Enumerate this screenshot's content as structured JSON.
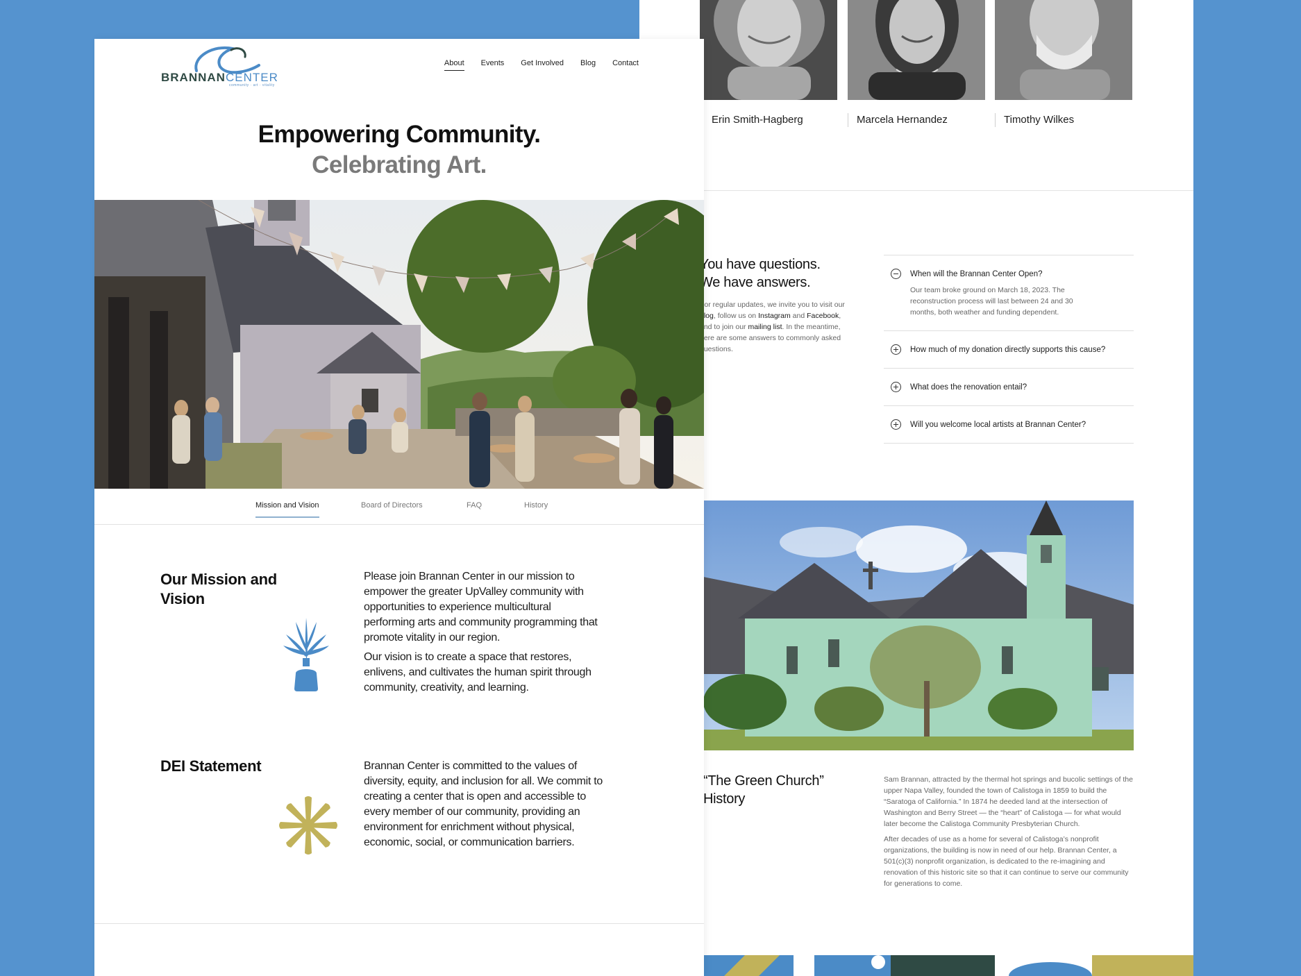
{
  "logo": {
    "name_bold": "BRANNAN",
    "name_light": "CENTER",
    "tagline": "community · art · vitality"
  },
  "nav": {
    "items": [
      {
        "label": "About",
        "active": true
      },
      {
        "label": "Events"
      },
      {
        "label": "Get Involved"
      },
      {
        "label": "Blog"
      },
      {
        "label": "Contact"
      }
    ]
  },
  "hero": {
    "line1": "Empowering Community.",
    "line2": "Celebrating Art."
  },
  "subtabs": [
    {
      "label": "Mission and Vision",
      "active": true
    },
    {
      "label": "Board of Directors"
    },
    {
      "label": "FAQ"
    },
    {
      "label": "History"
    }
  ],
  "mission": {
    "heading": "Our Mission and Vision",
    "p1": "Please join Brannan Center in our mission to empower the greater UpValley community with opportunities to experience multicultural performing arts and community programming that promote vitality in our region.",
    "p2": "Our vision is to create a space that restores, enlivens, and cultivates the human spirit through community, creativity, and learning."
  },
  "dei": {
    "heading": "DEI Statement",
    "p1": "Brannan Center is committed to the values of diversity, equity, and inclusion for all. We commit to creating a center that is open and accessible to every member of our community, providing an environment for enrichment without physical, economic, social, or communication barriers."
  },
  "board": {
    "members": [
      "Erin Smith-Hagberg",
      "Marcela Hernandez",
      "Timothy Wilkes"
    ]
  },
  "faq": {
    "heading_l1": "You have questions.",
    "heading_l2": "We have answers.",
    "intro_a": "For regular updates, we invite you to visit our ",
    "intro_blog": "blog",
    "intro_b": ", follow us on ",
    "intro_instagram": "Instagram",
    "intro_c": " and ",
    "intro_facebook": "Facebook",
    "intro_d": ", and to join our ",
    "intro_mailing": "mailing list",
    "intro_e": ". In the meantime, here are some answers to commonly asked questions.",
    "items": [
      {
        "q": "When will the Brannan Center Open?",
        "a": "Our team broke ground on March 18, 2023. The reconstruction process will last between 24 and 30 months, both weather and funding dependent.",
        "open": true
      },
      {
        "q": "How much of my donation directly supports this cause?"
      },
      {
        "q": "What does the renovation entail?"
      },
      {
        "q": "Will you welcome local artists at Brannan Center?"
      }
    ]
  },
  "history": {
    "heading_l1": "“The Green Church”",
    "heading_l2": "History",
    "p1": "Sam Brannan, attracted by the thermal hot springs and bucolic settings of the upper Napa Valley, founded the town of Calistoga in 1859 to build the “Saratoga of California.” In 1874 he deeded land at the intersection of Washington and Berry Street — the “heart” of Calistoga — for what would later become the Calistoga Community Presbyterian Church.",
    "p2": "After decades of use as a home for several of Calistoga’s nonprofit organizations, the building is now in need of our help. Brannan Center, a 501(c)(3) nonprofit organization, is dedicated to the re-imagining and renovation of this historic site so that it can continue to serve our community for generations to come."
  },
  "colors": {
    "background": "#5593cf",
    "accent_blue": "#4b8bc7",
    "accent_olive": "#c1b25a",
    "dark_green": "#2f4a44"
  }
}
